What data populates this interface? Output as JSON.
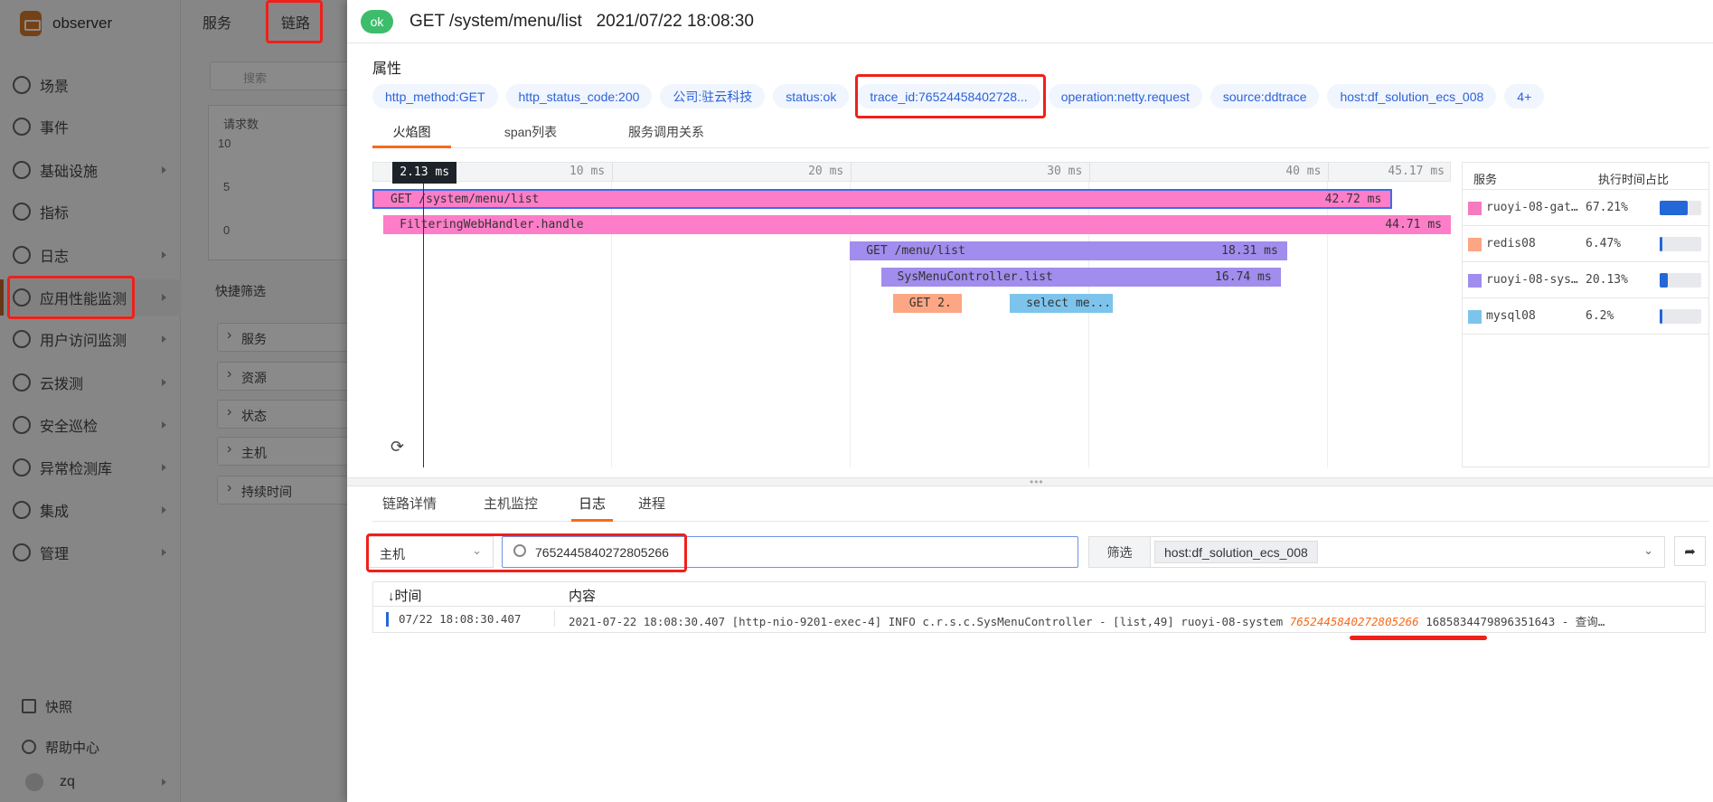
{
  "sidebar": {
    "brand": "observer",
    "items": [
      {
        "label": "场景",
        "icon": "dashboard-icon",
        "arrow": false
      },
      {
        "label": "事件",
        "icon": "flag-icon",
        "arrow": false
      },
      {
        "label": "基础设施",
        "icon": "grid-icon",
        "arrow": true
      },
      {
        "label": "指标",
        "icon": "metrics-icon",
        "arrow": false
      },
      {
        "label": "日志",
        "icon": "log-icon",
        "arrow": true
      },
      {
        "label": "应用性能监测",
        "icon": "apm-icon",
        "arrow": true,
        "active": true
      },
      {
        "label": "用户访问监测",
        "icon": "rum-icon",
        "arrow": true
      },
      {
        "label": "云拨测",
        "icon": "dialing-icon",
        "arrow": true
      },
      {
        "label": "安全巡检",
        "icon": "shield-icon",
        "arrow": true
      },
      {
        "label": "异常检测库",
        "icon": "monitor-icon",
        "arrow": true
      },
      {
        "label": "集成",
        "icon": "integration-icon",
        "arrow": true
      },
      {
        "label": "管理",
        "icon": "settings-icon",
        "arrow": true
      }
    ],
    "snapshot": "快照",
    "help": "帮助中心",
    "user": "zq"
  },
  "panel2": {
    "tabs": [
      "服务",
      "链路"
    ],
    "search_placeholder": "搜索",
    "chart_title": "请求数",
    "chart_ticks": [
      "10",
      "5",
      "0"
    ],
    "quick_filter": "快捷筛选",
    "filters": [
      "服务",
      "资源",
      "状态",
      "主机",
      "持续时间"
    ]
  },
  "drawer": {
    "status": "ok",
    "title": "GET /system/menu/list   2021/07/22 18:08:30",
    "attr_label": "属性",
    "tags": [
      "http_method:GET",
      "http_status_code:200",
      "公司:驻云科技",
      "status:ok",
      "trace_id:76524458402728...",
      "operation:netty.request",
      "source:ddtrace",
      "host:df_solution_ecs_008",
      "4+"
    ],
    "tabs": [
      "火焰图",
      "span列表",
      "服务调用关系"
    ]
  },
  "chart_data": {
    "type": "flame",
    "unit": "ms",
    "xlim": [
      0,
      45.17
    ],
    "cursor_label": "2.13 ms",
    "cursor": 2.13,
    "ticks": [
      {
        "v": 10,
        "label": "10 ms"
      },
      {
        "v": 20,
        "label": "20 ms"
      },
      {
        "v": 30,
        "label": "30 ms"
      },
      {
        "v": 40,
        "label": "40 ms"
      },
      {
        "v": 45.17,
        "label": "45.17 ms"
      }
    ],
    "spans": [
      {
        "name": "GET /system/menu/list",
        "duration_label": "42.72 ms",
        "start": 0,
        "duration": 42.72,
        "depth": 0,
        "color": "#fd7dc8",
        "selected": true
      },
      {
        "name": "FilteringWebHandler.handle",
        "duration_label": "44.71 ms",
        "start": 0.46,
        "duration": 44.71,
        "depth": 1,
        "color": "#fd7dc8"
      },
      {
        "name": "GET /menu/list",
        "duration_label": "18.31 ms",
        "start": 20.0,
        "duration": 18.31,
        "depth": 2,
        "color": "#a08ded"
      },
      {
        "name": "SysMenuController.list",
        "duration_label": "16.74 ms",
        "start": 21.3,
        "duration": 16.74,
        "depth": 3,
        "color": "#a08ded"
      },
      {
        "name": "GET 2.",
        "duration_label": "",
        "start": 21.8,
        "duration": 2.9,
        "depth": 4,
        "color": "#fca683"
      },
      {
        "name": "select me...",
        "duration_label": "",
        "start": 26.7,
        "duration": 4.3,
        "depth": 4,
        "color": "#7dc4ec"
      }
    ]
  },
  "legend": {
    "col_service": "服务",
    "col_ratio": "执行时间占比",
    "rows": [
      {
        "name": "ruoyi-08-gateway",
        "label": "ruoyi-08-gate…",
        "pct": "67.21%",
        "value": 67.21,
        "color": "#f57bbf"
      },
      {
        "name": "redis08",
        "label": "redis08",
        "pct": "6.47%",
        "value": 6.47,
        "color": "#fca683"
      },
      {
        "name": "ruoyi-08-system",
        "label": "ruoyi-08-syst…",
        "pct": "20.13%",
        "value": 20.13,
        "color": "#a08ded"
      },
      {
        "name": "mysql08",
        "label": "mysql08",
        "pct": "6.2%",
        "value": 6.2,
        "color": "#7dc4ec"
      }
    ]
  },
  "bottom": {
    "tabs": [
      "链路详情",
      "主机监控",
      "日志",
      "进程"
    ],
    "select_value": "主机",
    "search_value": "7652445840272805266",
    "filter_label": "筛选",
    "filter_chip": "host:df_solution_ecs_008",
    "table": {
      "col_time": "↓时间",
      "col_content": "内容",
      "rows": [
        {
          "time": "07/22 18:08:30.407",
          "content_pre": "2021-07-22 18:08:30.407 [http-nio-9201-exec-4] INFO c.r.s.c.SysMenuController - [list,49] ruoyi-08-system ",
          "content_hl": "7652445840272805266",
          "content_post": " 1685834479896351643 - 查询…"
        }
      ]
    }
  }
}
